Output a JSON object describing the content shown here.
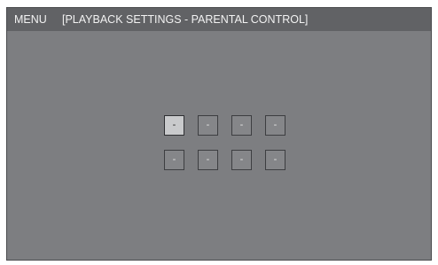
{
  "header": {
    "menu_label": "MENU",
    "title": "[PLAYBACK SETTINGS - PARENTAL CONTROL]"
  },
  "password": {
    "row1": [
      "-",
      "-",
      "-",
      "-"
    ],
    "row2": [
      "-",
      "-",
      "-",
      "-"
    ],
    "selected_row": 1,
    "selected_index": 1
  }
}
